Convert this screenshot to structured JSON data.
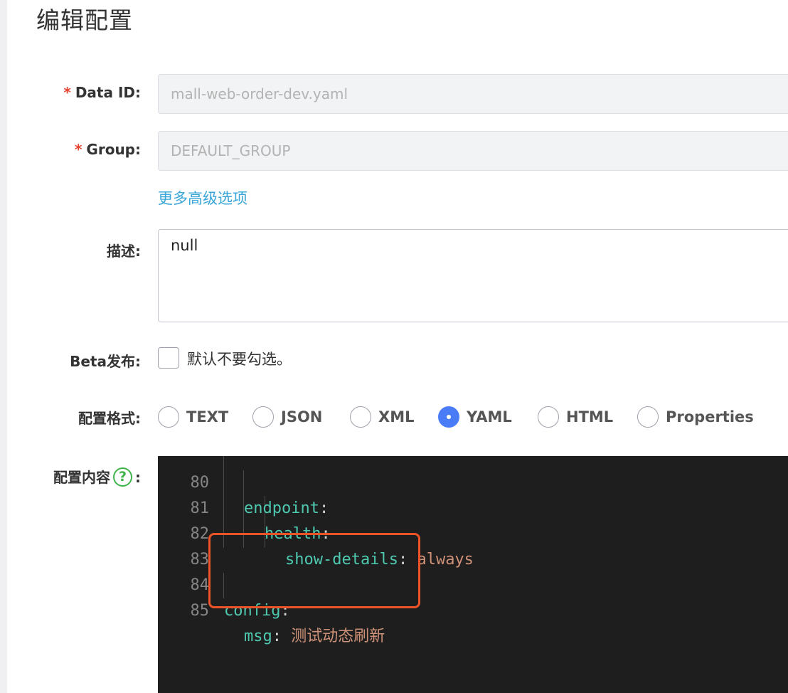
{
  "page": {
    "title": "编辑配置"
  },
  "form": {
    "required_mark": "*",
    "data_id": {
      "label": "Data ID:",
      "value": "mall-web-order-dev.yaml"
    },
    "group": {
      "label": "Group:",
      "value": "DEFAULT_GROUP"
    },
    "advanced_link": "更多高级选项",
    "description": {
      "label": "描述:",
      "value": "null"
    },
    "beta": {
      "label": "Beta发布:",
      "checkbox_text": "默认不要勾选。",
      "checked": false
    },
    "format": {
      "label": "配置格式:",
      "options": [
        "TEXT",
        "JSON",
        "XML",
        "YAML",
        "HTML",
        "Properties"
      ],
      "selected": "YAML"
    },
    "content": {
      "label": "配置内容",
      "help_icon": "question-circle-icon",
      "colon": ":"
    }
  },
  "editor": {
    "lines": [
      {
        "number": "80",
        "key": "endpoint",
        "sep": ":",
        "value": ""
      },
      {
        "number": "81",
        "key": "health",
        "sep": ":",
        "value": ""
      },
      {
        "number": "82",
        "key": "show-details",
        "sep": ": ",
        "value": "always"
      },
      {
        "number": "83",
        "key": "",
        "sep": "",
        "value": ""
      },
      {
        "number": "84",
        "key": "config",
        "sep": ":",
        "value": ""
      },
      {
        "number": "85",
        "key": "msg",
        "sep": ": ",
        "value": "测试动态刷新"
      }
    ]
  },
  "colors": {
    "accent": "#4a7cf7",
    "link": "#38a5d8",
    "required": "#e8462f",
    "highlight_box": "#eb5428",
    "editor_bg": "#1e1e1e",
    "yaml_key": "#4ec9b0",
    "yaml_string": "#ce9178"
  }
}
